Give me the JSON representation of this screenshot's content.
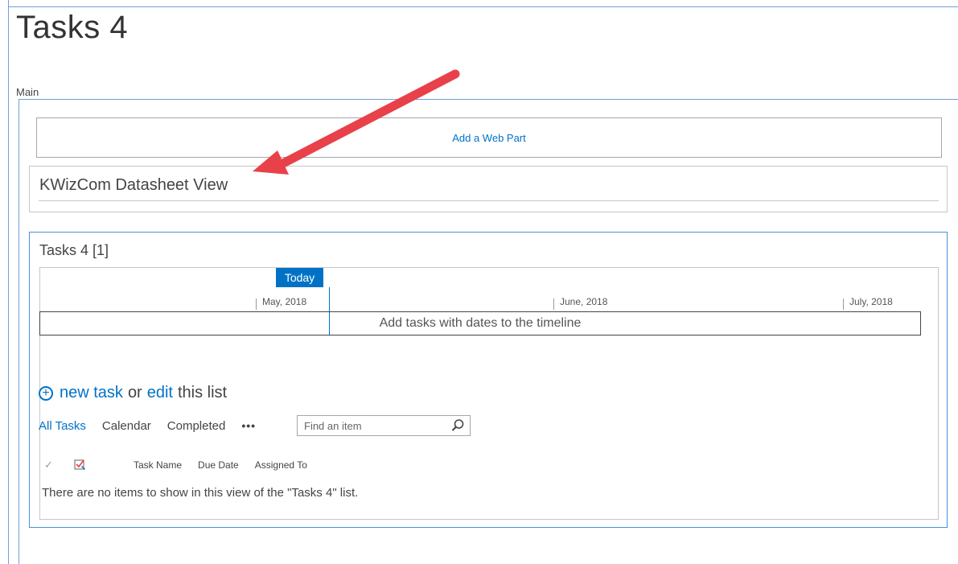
{
  "page": {
    "title": "Tasks 4",
    "zone_label": "Main"
  },
  "add_webpart": {
    "label": "Add a Web Part"
  },
  "kwizcom": {
    "title": "KWizCom Datasheet View"
  },
  "tasks_part": {
    "title": "Tasks 4 [1]",
    "timeline": {
      "today_label": "Today",
      "months": [
        "May, 2018",
        "June, 2018",
        "July, 2018"
      ],
      "placeholder": "Add tasks with dates to the timeline"
    },
    "new_task": {
      "new_label": "new task",
      "or_label": "or",
      "edit_label": "edit",
      "rest_label": "this list"
    },
    "views": {
      "all_tasks": "All Tasks",
      "calendar": "Calendar",
      "completed": "Completed",
      "more": "•••"
    },
    "search": {
      "placeholder": "Find an item"
    },
    "columns": {
      "check": "✓",
      "task_name": "Task Name",
      "due_date": "Due Date",
      "assigned_to": "Assigned To"
    },
    "empty_message": "There are no items to show in this view of the \"Tasks 4\" list."
  },
  "colors": {
    "accent": "#0072c6",
    "annotation_arrow": "#e8414a"
  }
}
